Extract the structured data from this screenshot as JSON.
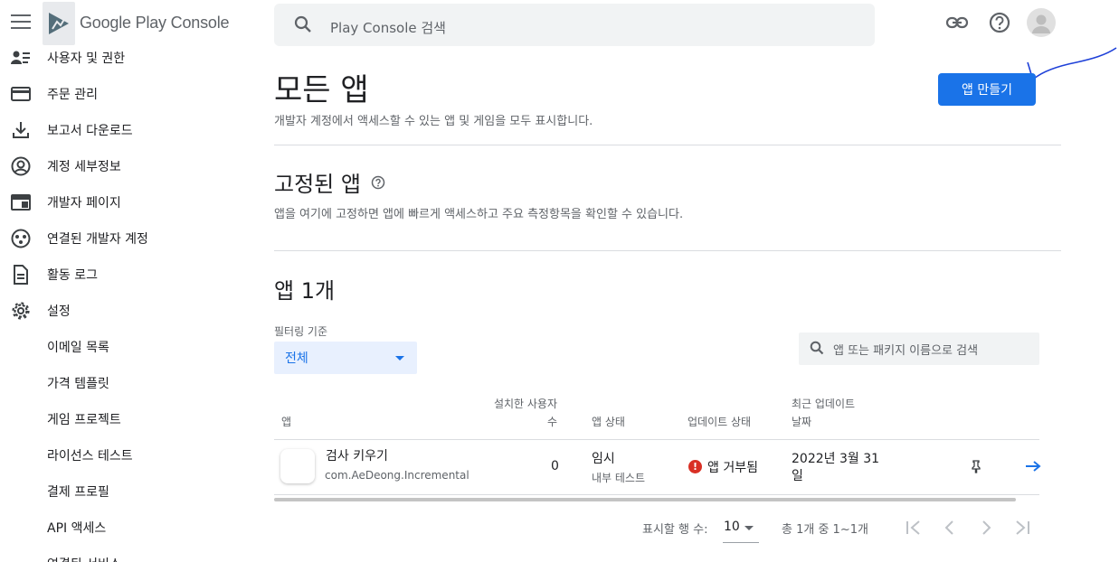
{
  "header": {
    "logo_text": "Google Play Console",
    "search_placeholder": "Play Console 검색"
  },
  "sidebar": {
    "items": [
      {
        "label": "사용자 및 권한",
        "icon": "person-list-icon"
      },
      {
        "label": "주문 관리",
        "icon": "credit-card-icon"
      },
      {
        "label": "보고서 다운로드",
        "icon": "download-icon"
      },
      {
        "label": "계정 세부정보",
        "icon": "account-circle-icon"
      },
      {
        "label": "개발자 페이지",
        "icon": "web-page-icon"
      },
      {
        "label": "연결된 개발자 계정",
        "icon": "linked-accounts-icon"
      },
      {
        "label": "활동 로그",
        "icon": "document-icon"
      },
      {
        "label": "설정",
        "icon": "gear-icon"
      },
      {
        "label": "이메일 목록",
        "icon": ""
      },
      {
        "label": "가격 템플릿",
        "icon": ""
      },
      {
        "label": "게임 프로젝트",
        "icon": ""
      },
      {
        "label": "라이선스 테스트",
        "icon": ""
      },
      {
        "label": "결제 프로필",
        "icon": ""
      },
      {
        "label": "API 액세스",
        "icon": ""
      },
      {
        "label": "연결된 서비스",
        "icon": ""
      }
    ]
  },
  "main": {
    "title": "모든 앱",
    "description": "개발자 계정에서 액세스할 수 있는 앱 및 게임을 모두 표시합니다.",
    "create_button": "앱 만들기",
    "pinned": {
      "title": "고정된 앱",
      "description": "앱을 여기에 고정하면 앱에 빠르게 액세스하고 주요 측정항목을 확인할 수 있습니다."
    },
    "apps": {
      "title": "앱 1개",
      "filter_label": "필터링 기준",
      "filter_value": "전체",
      "search_placeholder": "앱 또는 패키지 이름으로 검색",
      "columns": {
        "app": "앱",
        "installs_line1": "설치한 사용자",
        "installs_line2": "수",
        "status": "앱 상태",
        "update_status": "업데이트 상태",
        "last_update_line1": "최근 업데이트",
        "last_update_line2": "날짜"
      },
      "rows": [
        {
          "name": "검사 키우기",
          "package": "com.AeDeong.Incremental",
          "installs": "0",
          "status": "임시",
          "status_sub": "내부 테스트",
          "update_status": "앱 거부됨",
          "date_line1": "2022년 3월 31",
          "date_line2": "일"
        }
      ]
    },
    "pagination": {
      "rows_label": "표시할 행 수:",
      "rows_value": "10",
      "range": "총 1개 중 1~1개"
    }
  }
}
